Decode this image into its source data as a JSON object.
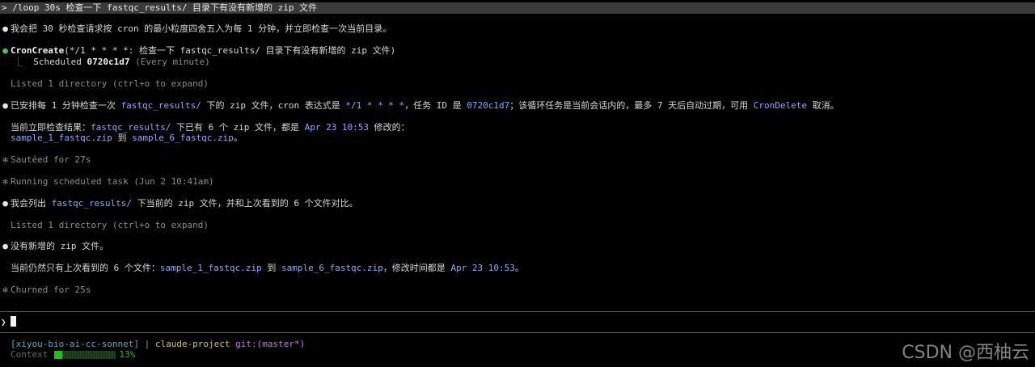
{
  "command": {
    "prompt_mark": ">",
    "text": "/loop 30s 检查一下 fastqc_results/ 目录下有没有新增的 zip 文件"
  },
  "messages": {
    "m1": "我会把 30 秒检查请求按 cron 的最小粒度四舍五入为每 1 分钟，并立即检查一次当前目录。",
    "cron_fn": "CronCreate",
    "cron_args": "(*/1 * * * *: 检查一下 fastqc_results/ 目录下有没有新增的 zip 文件)",
    "tree_mark": "⎿",
    "scheduled_label": "Scheduled",
    "scheduled_id": "0720c1d7",
    "scheduled_note": "(Every minute)",
    "listed1": "Listed 1 directory (ctrl+o to expand)",
    "m2_a": "已安排每 1 分钟检查一次 ",
    "m2_path": "fastqc_results/",
    "m2_b": " 下的 zip 文件，cron 表达式是 ",
    "m2_cron": "*/1 * * * *",
    "m2_c": "，任务 ID 是 ",
    "m2_id": "0720c1d7",
    "m2_d": "；该循环任务是当前会话内的，最多 7 天后自动过期，可用 ",
    "m2_delete": "CronDelete",
    "m2_e": " 取消。",
    "m3_a": "当前立即检查结果：",
    "m3_path": "fastqc_results/",
    "m3_b": " 下已有 6 个 zip 文件，都是 ",
    "m3_date": "Apr 23 10:53",
    "m3_c": " 修改的：",
    "m3_file1": "sample_1_fastqc.zip",
    "m3_to": " 到 ",
    "m3_file2": "sample_6_fastqc.zip",
    "m3_end": "。",
    "sauteed": "Sautéed for 27s",
    "running": "Running scheduled task (Jun 2 10:41am)",
    "m4_a": "我会列出 ",
    "m4_path": "fastqc_results/",
    "m4_b": " 下当前的 zip 文件，并和上次看到的 6 个文件对比。",
    "listed2": "Listed 1 directory (ctrl+o to expand)",
    "m5": "没有新增的 zip 文件。",
    "m6_a": "当前仍然只有上次看到的 6 个文件：",
    "m6_file1": "sample_1_fastqc.zip",
    "m6_to": " 到 ",
    "m6_file2": "sample_6_fastqc.zip",
    "m6_b": "，修改时间都是 ",
    "m6_date": "Apr 23 10:53",
    "m6_end": "。",
    "churned": "Churned for 25s"
  },
  "glyphs": {
    "bullet": "●",
    "star": "✻",
    "chevron": "❯"
  },
  "status": {
    "env": "[xiyou-bio-ai-cc-sonnet]",
    "pipe": "|",
    "project": "claude-project",
    "git_label": "git:",
    "git_branch": "(master*)",
    "context_label": "Context",
    "context_fraction": 0.13,
    "context_pct": "13%"
  },
  "watermark": "CSDN @西柚云",
  "colors": {
    "background": "#000000",
    "highlight": "#8fa8ff",
    "bullet_green": "#4ec34e",
    "context_green": "#21c021"
  }
}
